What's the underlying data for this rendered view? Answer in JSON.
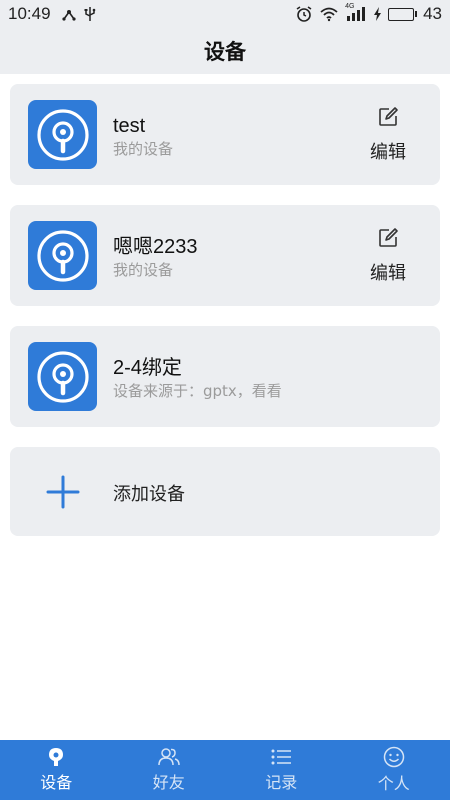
{
  "status_bar": {
    "time": "10:49",
    "network_label": "4G",
    "battery": "43",
    "battery_level": 0.43,
    "icons": [
      "usb-tether-icon",
      "usb-icon",
      "alarm-icon",
      "wifi-icon",
      "signal-icon",
      "charging-icon",
      "battery-icon"
    ]
  },
  "header": {
    "title": "设备"
  },
  "devices": [
    {
      "name": "test",
      "subtitle": "我的设备",
      "edit_label": "编辑",
      "icon": "device-icon"
    },
    {
      "name": "嗯嗯2233",
      "subtitle": "我的设备",
      "edit_label": "编辑",
      "icon": "device-icon"
    },
    {
      "name": "2-4绑定",
      "subtitle": "设备来源于：gptx，看看",
      "icon": "device-icon"
    }
  ],
  "add_device": {
    "label": "添加设备",
    "icon": "plus-icon"
  },
  "tabs": [
    {
      "label": "设备",
      "icon": "location-pin-icon",
      "active": true
    },
    {
      "label": "好友",
      "icon": "friends-icon",
      "active": false
    },
    {
      "label": "记录",
      "icon": "list-icon",
      "active": false
    },
    {
      "label": "个人",
      "icon": "smiley-icon",
      "active": false
    }
  ],
  "colors": {
    "accent": "#2f7bd8",
    "card_bg": "#eceef1",
    "header_bg": "#eceef1",
    "subtitle": "#9b9b9b"
  }
}
